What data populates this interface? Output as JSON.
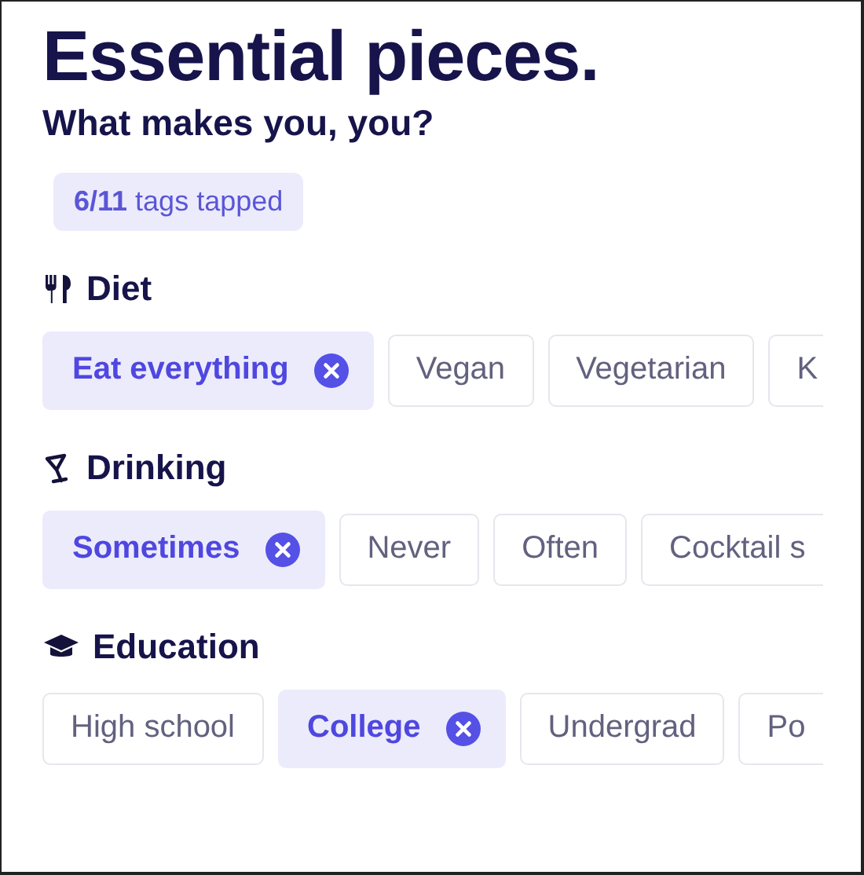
{
  "title": "Essential pieces.",
  "subtitle": "What makes you, you?",
  "counter": {
    "count": "6/11",
    "label": "tags tapped"
  },
  "sections": [
    {
      "kind": "diet",
      "title": "Diet",
      "tags": [
        {
          "label": "Eat everything",
          "selected": true,
          "cut_off": false
        },
        {
          "label": "Vegan",
          "selected": false,
          "cut_off": false
        },
        {
          "label": "Vegetarian",
          "selected": false,
          "cut_off": false
        },
        {
          "label": "K",
          "selected": false,
          "cut_off": true
        }
      ]
    },
    {
      "kind": "drinking",
      "title": "Drinking",
      "tags": [
        {
          "label": "Sometimes",
          "selected": true,
          "cut_off": false
        },
        {
          "label": "Never",
          "selected": false,
          "cut_off": false
        },
        {
          "label": "Often",
          "selected": false,
          "cut_off": false
        },
        {
          "label": "Cocktail s",
          "selected": false,
          "cut_off": true
        }
      ]
    },
    {
      "kind": "education",
      "title": "Education",
      "tags": [
        {
          "label": "High school",
          "selected": false,
          "cut_off": false
        },
        {
          "label": "College",
          "selected": true,
          "cut_off": false
        },
        {
          "label": "Undergrad",
          "selected": false,
          "cut_off": false
        },
        {
          "label": "Po",
          "selected": false,
          "cut_off": true
        }
      ]
    }
  ]
}
